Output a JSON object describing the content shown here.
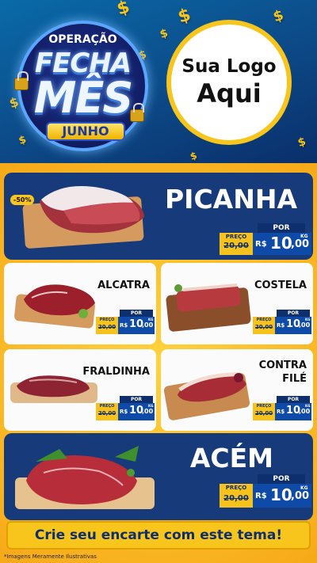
{
  "header": {
    "badge_top": "OPERAÇÃO",
    "badge_line1": "FECHA",
    "badge_line2": "MÊS",
    "badge_month": "JUNHO",
    "logo_line1": "Sua Logo",
    "logo_line2": "Aqui",
    "dollar_symbol": "$"
  },
  "discount_tag": "-50%",
  "price_labels": {
    "por": "POR",
    "preco": "PREÇO",
    "currency": "R$",
    "unit": "KG"
  },
  "products": [
    {
      "name": "PICANHA",
      "old_price": "20,00",
      "price_int": "10",
      "price_dec": ",00"
    },
    {
      "name": "ALCATRA",
      "old_price": "20,00",
      "price_int": "10",
      "price_dec": ",00"
    },
    {
      "name": "COSTELA",
      "old_price": "20,00",
      "price_int": "10",
      "price_dec": ",00"
    },
    {
      "name": "FRALDINHA",
      "old_price": "20,00",
      "price_int": "10",
      "price_dec": ",00"
    },
    {
      "name_line1": "CONTRA",
      "name_line2": "FILÉ",
      "old_price": "20,00",
      "price_int": "10",
      "price_dec": ",00"
    },
    {
      "name": "ACÉM",
      "old_price": "20,00",
      "price_int": "10",
      "price_dec": ",00"
    }
  ],
  "cta_text": "Crie seu encarte com este tema!",
  "footnote": "*Imagens Meramente Ilustrativas",
  "colors": {
    "navy": "#173b7a",
    "yellow": "#f7c51b",
    "blue_price": "#0e4aa8"
  }
}
